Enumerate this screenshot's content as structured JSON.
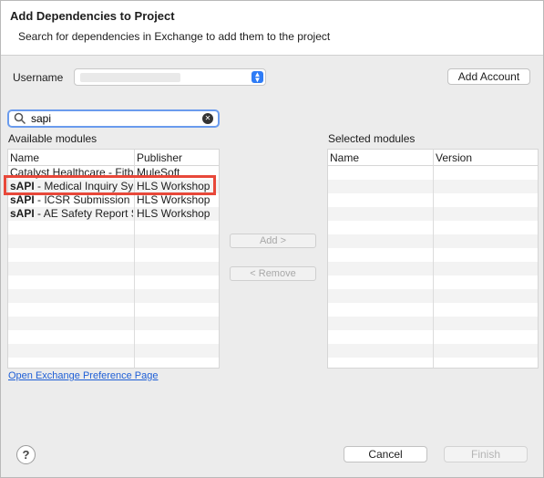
{
  "dialog": {
    "title": "Add Dependencies to Project",
    "subtitle": "Search for dependencies in Exchange to add them to the project"
  },
  "username": {
    "label": "Username",
    "value": "",
    "add_account_label": "Add Account"
  },
  "search": {
    "value": "sapi"
  },
  "available": {
    "label": "Available modules",
    "columns": [
      "Name",
      "Publisher"
    ],
    "rows": [
      {
        "name_bold": "",
        "name_rest": "Catalyst Healthcare - Fitbi",
        "publisher": "MuleSoft"
      },
      {
        "name_bold": "sAPI",
        "name_rest": " - Medical Inquiry Sys",
        "publisher": "HLS Workshop"
      },
      {
        "name_bold": "sAPI",
        "name_rest": " - ICSR Submission tc",
        "publisher": "HLS Workshop"
      },
      {
        "name_bold": "sAPI",
        "name_rest": " - AE Safety Report S",
        "publisher": "HLS Workshop"
      }
    ]
  },
  "selected": {
    "label": "Selected modules",
    "columns": [
      "Name",
      "Version"
    ]
  },
  "buttons": {
    "add": "Add >",
    "remove": "< Remove",
    "cancel": "Cancel",
    "finish": "Finish",
    "help": "?"
  },
  "link": {
    "text": "Open Exchange Preference Page"
  },
  "colors": {
    "highlight": "#e8483a",
    "focus_ring": "#6a9bed",
    "link": "#1f5fd6"
  }
}
